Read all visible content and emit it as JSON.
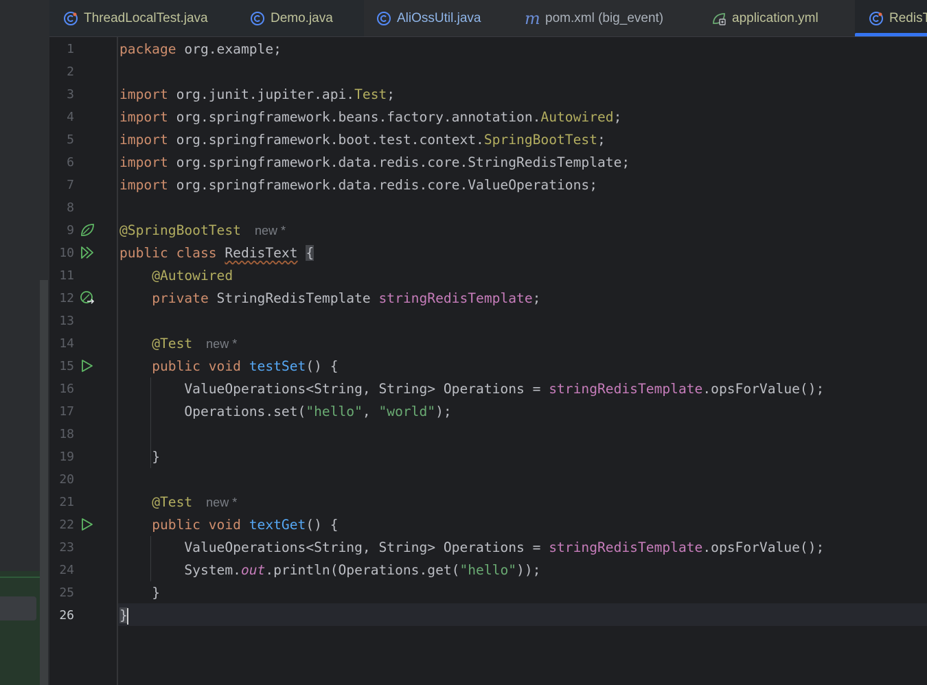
{
  "tabs": [
    {
      "label": "ThreadLocalTest.java",
      "icon": "java-class-icon",
      "style": "java"
    },
    {
      "label": "Demo.java",
      "icon": "java-class-icon",
      "style": "java"
    },
    {
      "label": "AliOssUtil.java",
      "icon": "java-class-icon",
      "style": "java"
    },
    {
      "label": "pom.xml (big_event)",
      "icon": "maven-m-icon",
      "style": "maven"
    },
    {
      "label": "application.yml",
      "icon": "spring-config-icon",
      "style": "java"
    },
    {
      "label": "RedisT",
      "icon": "java-class-icon",
      "style": "java"
    }
  ],
  "active_tab_index": 5,
  "line_numbers": [
    "1",
    "2",
    "3",
    "4",
    "5",
    "6",
    "7",
    "8",
    "9",
    "10",
    "11",
    "12",
    "13",
    "14",
    "15",
    "16",
    "17",
    "18",
    "19",
    "20",
    "21",
    "22",
    "23",
    "24",
    "25",
    "26"
  ],
  "current_line": 26,
  "code": {
    "l1": [
      "package",
      " org.example;"
    ],
    "l3": [
      "import",
      " org.junit.jupiter.api.",
      "Test",
      ";"
    ],
    "l4": [
      "import",
      " org.springframework.beans.factory.annotation.",
      "Autowired",
      ";"
    ],
    "l5": [
      "import",
      " org.springframework.boot.test.context.",
      "SpringBootTest",
      ";"
    ],
    "l6": [
      "import",
      " org.springframework.data.redis.core.StringRedisTemplate;"
    ],
    "l7": [
      "import",
      " org.springframework.data.redis.core.ValueOperations;"
    ],
    "l9": [
      "@SpringBootTest"
    ],
    "l9_hint": "new *",
    "l10": [
      "public class ",
      "RedisText",
      " ",
      "{"
    ],
    "l11": [
      "@Autowired"
    ],
    "l12": [
      "private",
      " StringRedisTemplate ",
      "stringRedisTemplate",
      ";"
    ],
    "l14": [
      "@Test"
    ],
    "l14_hint": "new *",
    "l15": [
      "public void ",
      "testSet",
      "() {"
    ],
    "l16": [
      "ValueOperations<String, String> Operations = ",
      "stringRedisTemplate",
      ".opsForValue();"
    ],
    "l17": [
      "Operations.set(",
      "\"hello\"",
      ", ",
      "\"world\"",
      ");"
    ],
    "l19": [
      "}"
    ],
    "l21": [
      "@Test"
    ],
    "l21_hint": "new *",
    "l22": [
      "public void ",
      "textGet",
      "() {"
    ],
    "l23": [
      "ValueOperations<String, String> Operations = ",
      "stringRedisTemplate",
      ".opsForValue();"
    ],
    "l24": [
      "System.",
      "out",
      ".println(Operations.get(",
      "\"hello\"",
      "));"
    ],
    "l25": [
      "}"
    ],
    "l26": [
      "}"
    ]
  },
  "gutter_icons": [
    {
      "line": 9,
      "icon": "spring-bean-icon"
    },
    {
      "line": 10,
      "icon": "run-all-tests-icon"
    },
    {
      "line": 12,
      "icon": "spring-autowire-navigate-icon"
    },
    {
      "line": 15,
      "icon": "run-test-icon"
    },
    {
      "line": 22,
      "icon": "run-test-icon"
    }
  ],
  "colors": {
    "background": "#1e1f22",
    "keyword": "#cf8e6d",
    "annotation": "#b3ae60",
    "field": "#c77dbb",
    "method": "#56a8f5",
    "string": "#6aab73",
    "accent": "#3574f0",
    "run_icon": "#5fb865"
  }
}
